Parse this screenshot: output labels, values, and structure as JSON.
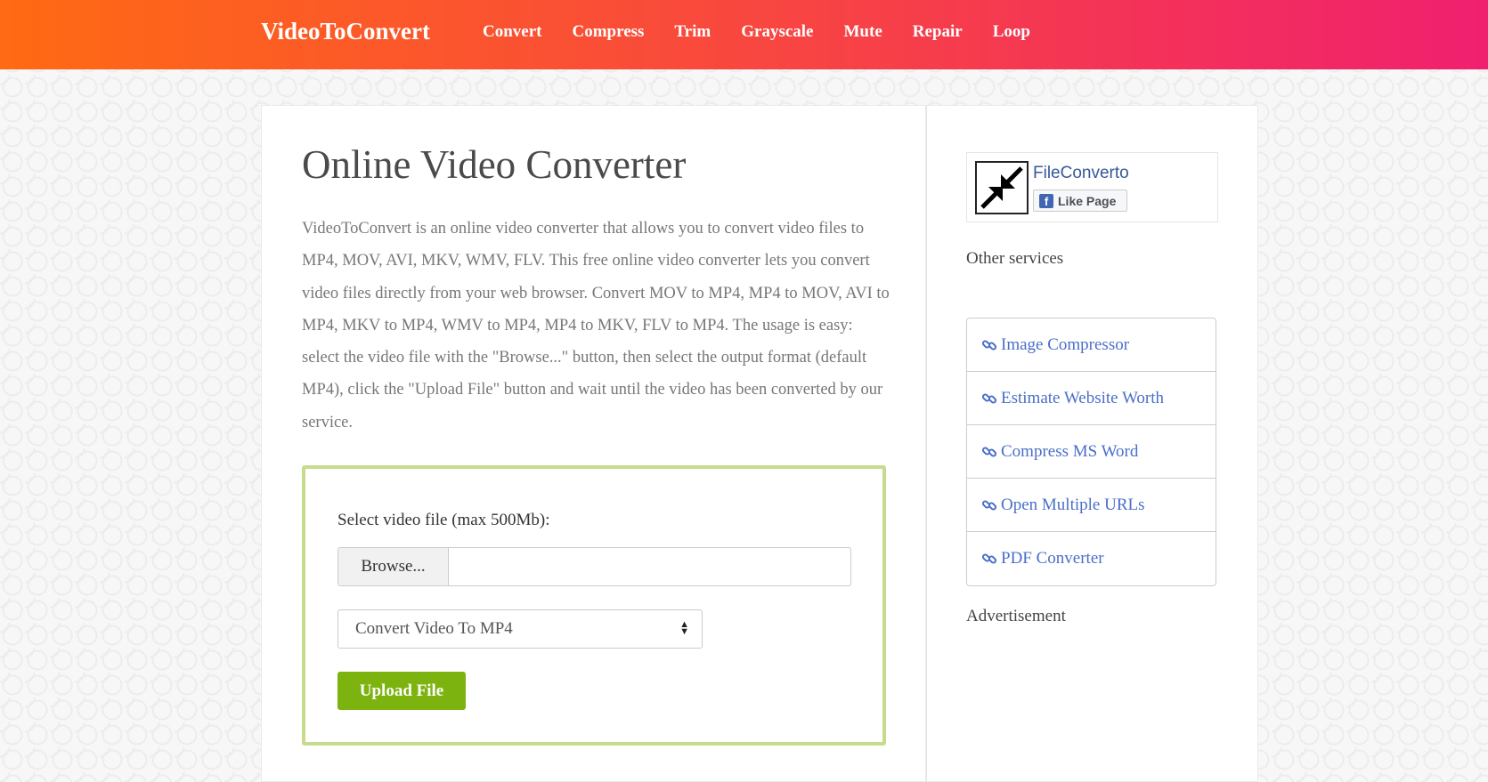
{
  "header": {
    "brand": "VideoToConvert",
    "nav": [
      "Convert",
      "Compress",
      "Trim",
      "Grayscale",
      "Mute",
      "Repair",
      "Loop"
    ]
  },
  "main": {
    "title": "Online Video Converter",
    "intro": "VideoToConvert is an online video converter that allows you to convert video files to MP4, MOV, AVI, MKV, WMV, FLV. This free online video converter lets you convert video files directly from your web browser. Convert MOV to MP4, MP4 to MOV, AVI to MP4, MKV to MP4, WMV to MP4, MP4 to MKV, FLV to MP4. The usage is easy: select the video file with the \"Browse...\" button, then select the output format (default MP4), click the \"Upload File\" button and wait until the video has been converted by our service.",
    "upload": {
      "label": "Select video file (max 500Mb):",
      "browse_label": "Browse...",
      "file_name": "",
      "format_selected": "Convert Video To MP4",
      "upload_label": "Upload File"
    }
  },
  "sidebar": {
    "fb_page_name": "FileConverto",
    "fb_like_label": "Like Page",
    "other_services_heading": "Other services",
    "services": [
      "Image Compressor",
      "Estimate Website Worth",
      "Compress MS Word",
      "Open Multiple URLs",
      "PDF Converter"
    ],
    "advertisement_heading": "Advertisement"
  },
  "colors": {
    "header_gradient_start": "#ff6a13",
    "header_gradient_end": "#f0206f",
    "upload_border": "#c6dc8c",
    "upload_button": "#7cb30f",
    "link": "#4a6fc9"
  }
}
